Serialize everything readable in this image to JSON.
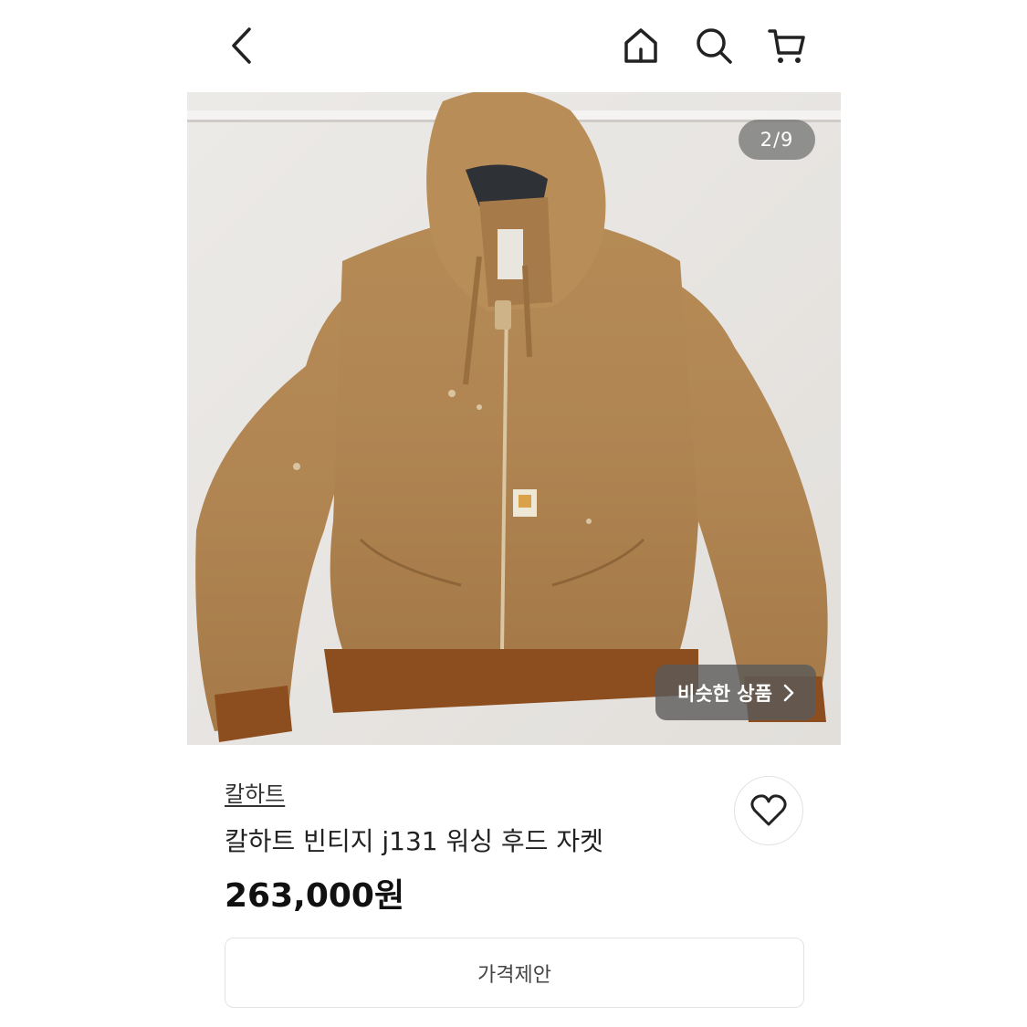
{
  "header": {
    "back_icon": "chevron-left-icon",
    "home_icon": "home-icon",
    "search_icon": "search-icon",
    "cart_icon": "cart-icon"
  },
  "gallery": {
    "counter": "2/9",
    "current": 2,
    "total": 9,
    "similar_label": "비슷한 상품"
  },
  "product": {
    "brand": "칼하트",
    "title": "칼하트 빈티지 j131 워싱 후드 자켓",
    "price": "263,000원"
  },
  "actions": {
    "offer_label": "가격제안",
    "like_icon": "heart-icon"
  }
}
